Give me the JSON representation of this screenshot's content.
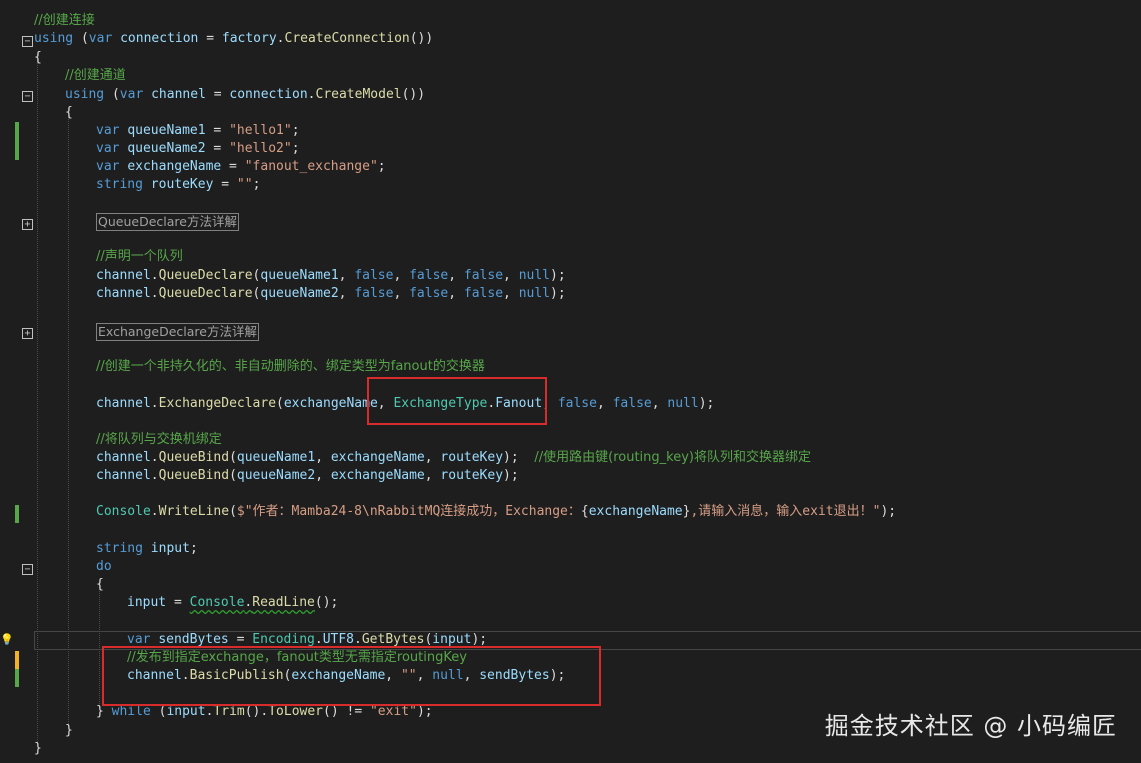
{
  "editor": {
    "lines": {
      "l1": {
        "c1": "//创建连接"
      },
      "l2": {
        "a": "using",
        "b": " (",
        "c": "var",
        "d": " ",
        "e": "connection",
        "f": " = ",
        "g": "factory",
        "h": ".",
        "i": "CreateConnection",
        "j": "())"
      },
      "l3": {
        "a": "{"
      },
      "l4": {
        "c1": "//创建通道"
      },
      "l5": {
        "a": "using",
        "b": " (",
        "c": "var",
        "d": " ",
        "e": "channel",
        "f": " = ",
        "g": "connection",
        "h": ".",
        "i": "CreateModel",
        "j": "())"
      },
      "l6": {
        "a": "{"
      },
      "l7": {
        "a": "var",
        "b": " ",
        "c": "queueName1",
        "d": " = ",
        "e": "\"hello1\"",
        "f": ";"
      },
      "l8": {
        "a": "var",
        "b": " ",
        "c": "queueName2",
        "d": " = ",
        "e": "\"hello2\"",
        "f": ";"
      },
      "l9": {
        "a": "var",
        "b": " ",
        "c": "exchangeName",
        "d": " = ",
        "e": "\"fanout_exchange\"",
        "f": ";"
      },
      "l10": {
        "a": "string",
        "b": " ",
        "c": "routeKey",
        "d": " = ",
        "e": "\"\"",
        "f": ";"
      },
      "l11": {
        "box": "QueueDeclare方法详解"
      },
      "l12": {
        "c1": "//声明一个队列"
      },
      "l13": {
        "a": "channel",
        "b": ".",
        "c": "QueueDeclare",
        "d": "(",
        "e": "queueName1",
        "f": ", ",
        "g": "false",
        "h": ", ",
        "i": "false",
        "j": ", ",
        "k": "false",
        "l": ", ",
        "m": "null",
        "n": ");"
      },
      "l14": {
        "a": "channel",
        "b": ".",
        "c": "QueueDeclare",
        "d": "(",
        "e": "queueName2",
        "f": ", ",
        "g": "false",
        "h": ", ",
        "i": "false",
        "j": ", ",
        "k": "false",
        "l": ", ",
        "m": "null",
        "n": ");"
      },
      "l15": {
        "box": "ExchangeDeclare方法详解"
      },
      "l16": {
        "c1": "//创建一个非持久化的、非自动删除的、绑定类型为fanout的交换器"
      },
      "l17": {
        "a": "channel",
        "b": ".",
        "c": "ExchangeDeclare",
        "d": "(",
        "e": "exchangeName",
        "f": ", ",
        "g": "ExchangeType",
        "h": ".",
        "i": "Fanout",
        "j": ", ",
        "k": "false",
        "l": ", ",
        "m": "false",
        "n": ", ",
        "o": "null",
        "p": ");"
      },
      "l18": {
        "c1": "//将队列与交换机绑定"
      },
      "l19": {
        "a": "channel",
        "b": ".",
        "c": "QueueBind",
        "d": "(",
        "e": "queueName1",
        "f": ", ",
        "g": "exchangeName",
        "h": ", ",
        "i": "routeKey",
        "j": ");  ",
        "c1": "//使用路由键(routing_key)将队列和交换器绑定"
      },
      "l20": {
        "a": "channel",
        "b": ".",
        "c": "QueueBind",
        "d": "(",
        "e": "queueName2",
        "f": ", ",
        "g": "exchangeName",
        "h": ", ",
        "i": "routeKey",
        "j": ");"
      },
      "l21": {
        "a": "Console",
        "b": ".",
        "c": "WriteLine",
        "d": "(",
        "e": "$\"作者：Mamba24-8\\nRabbitMQ连接成功，Exchange：",
        "f": "{",
        "g": "exchangeName",
        "h": "}",
        "i": ",请输入消息，输入exit退出！\"",
        "j": ");"
      },
      "l22": {
        "a": "string",
        "b": " ",
        "c": "input",
        "d": ";"
      },
      "l23": {
        "a": "do"
      },
      "l24": {
        "a": "{"
      },
      "l25": {
        "a": "input",
        "b": " = ",
        "c": "Console",
        "d": ".",
        "e": "ReadLine",
        "f": "();"
      },
      "l26": {
        "a": "var",
        "b": " ",
        "c": "sendBytes",
        "d": " = ",
        "e": "Encoding",
        "f": ".",
        "g": "UTF8",
        "h": ".",
        "i": "GetBytes",
        "j": "(",
        "k": "input",
        "l": ");"
      },
      "l27": {
        "c1": "//发布到指定exchange，fanout类型无需指定routingKey"
      },
      "l28": {
        "a": "channel",
        "b": ".",
        "c": "BasicPublish",
        "d": "(",
        "e": "exchangeName",
        "f": ", ",
        "g": "\"\"",
        "h": ", ",
        "i": "null",
        "j": ", ",
        "k": "sendBytes",
        "l": ");"
      },
      "l29": {
        "a": "}",
        "b": " ",
        "c": "while",
        "d": " (",
        "e": "input",
        "f": ".",
        "g": "Trim",
        "h": "().",
        "i": "ToLower",
        "j": "() != ",
        "k": "\"exit\"",
        "l": ");"
      },
      "l30": {
        "a": "}"
      },
      "l31": {
        "a": "}"
      }
    },
    "fold_glyphs": {
      "minus": "−",
      "plus": "+"
    },
    "lightbulb_icon": "💡"
  },
  "watermark": {
    "text": "掘金技术社区 @ 小码编匠"
  },
  "colors": {
    "background": "#1e1e1e",
    "keyword": "#569cd6",
    "comment": "#57a64a",
    "string": "#d69d85",
    "variable": "#9cdcfe",
    "type": "#4ec9b0",
    "method": "#dcdcaa",
    "highlight_box": "#d82c2c",
    "change_mark_green": "#57a64a",
    "change_mark_yellow": "#efb325"
  }
}
